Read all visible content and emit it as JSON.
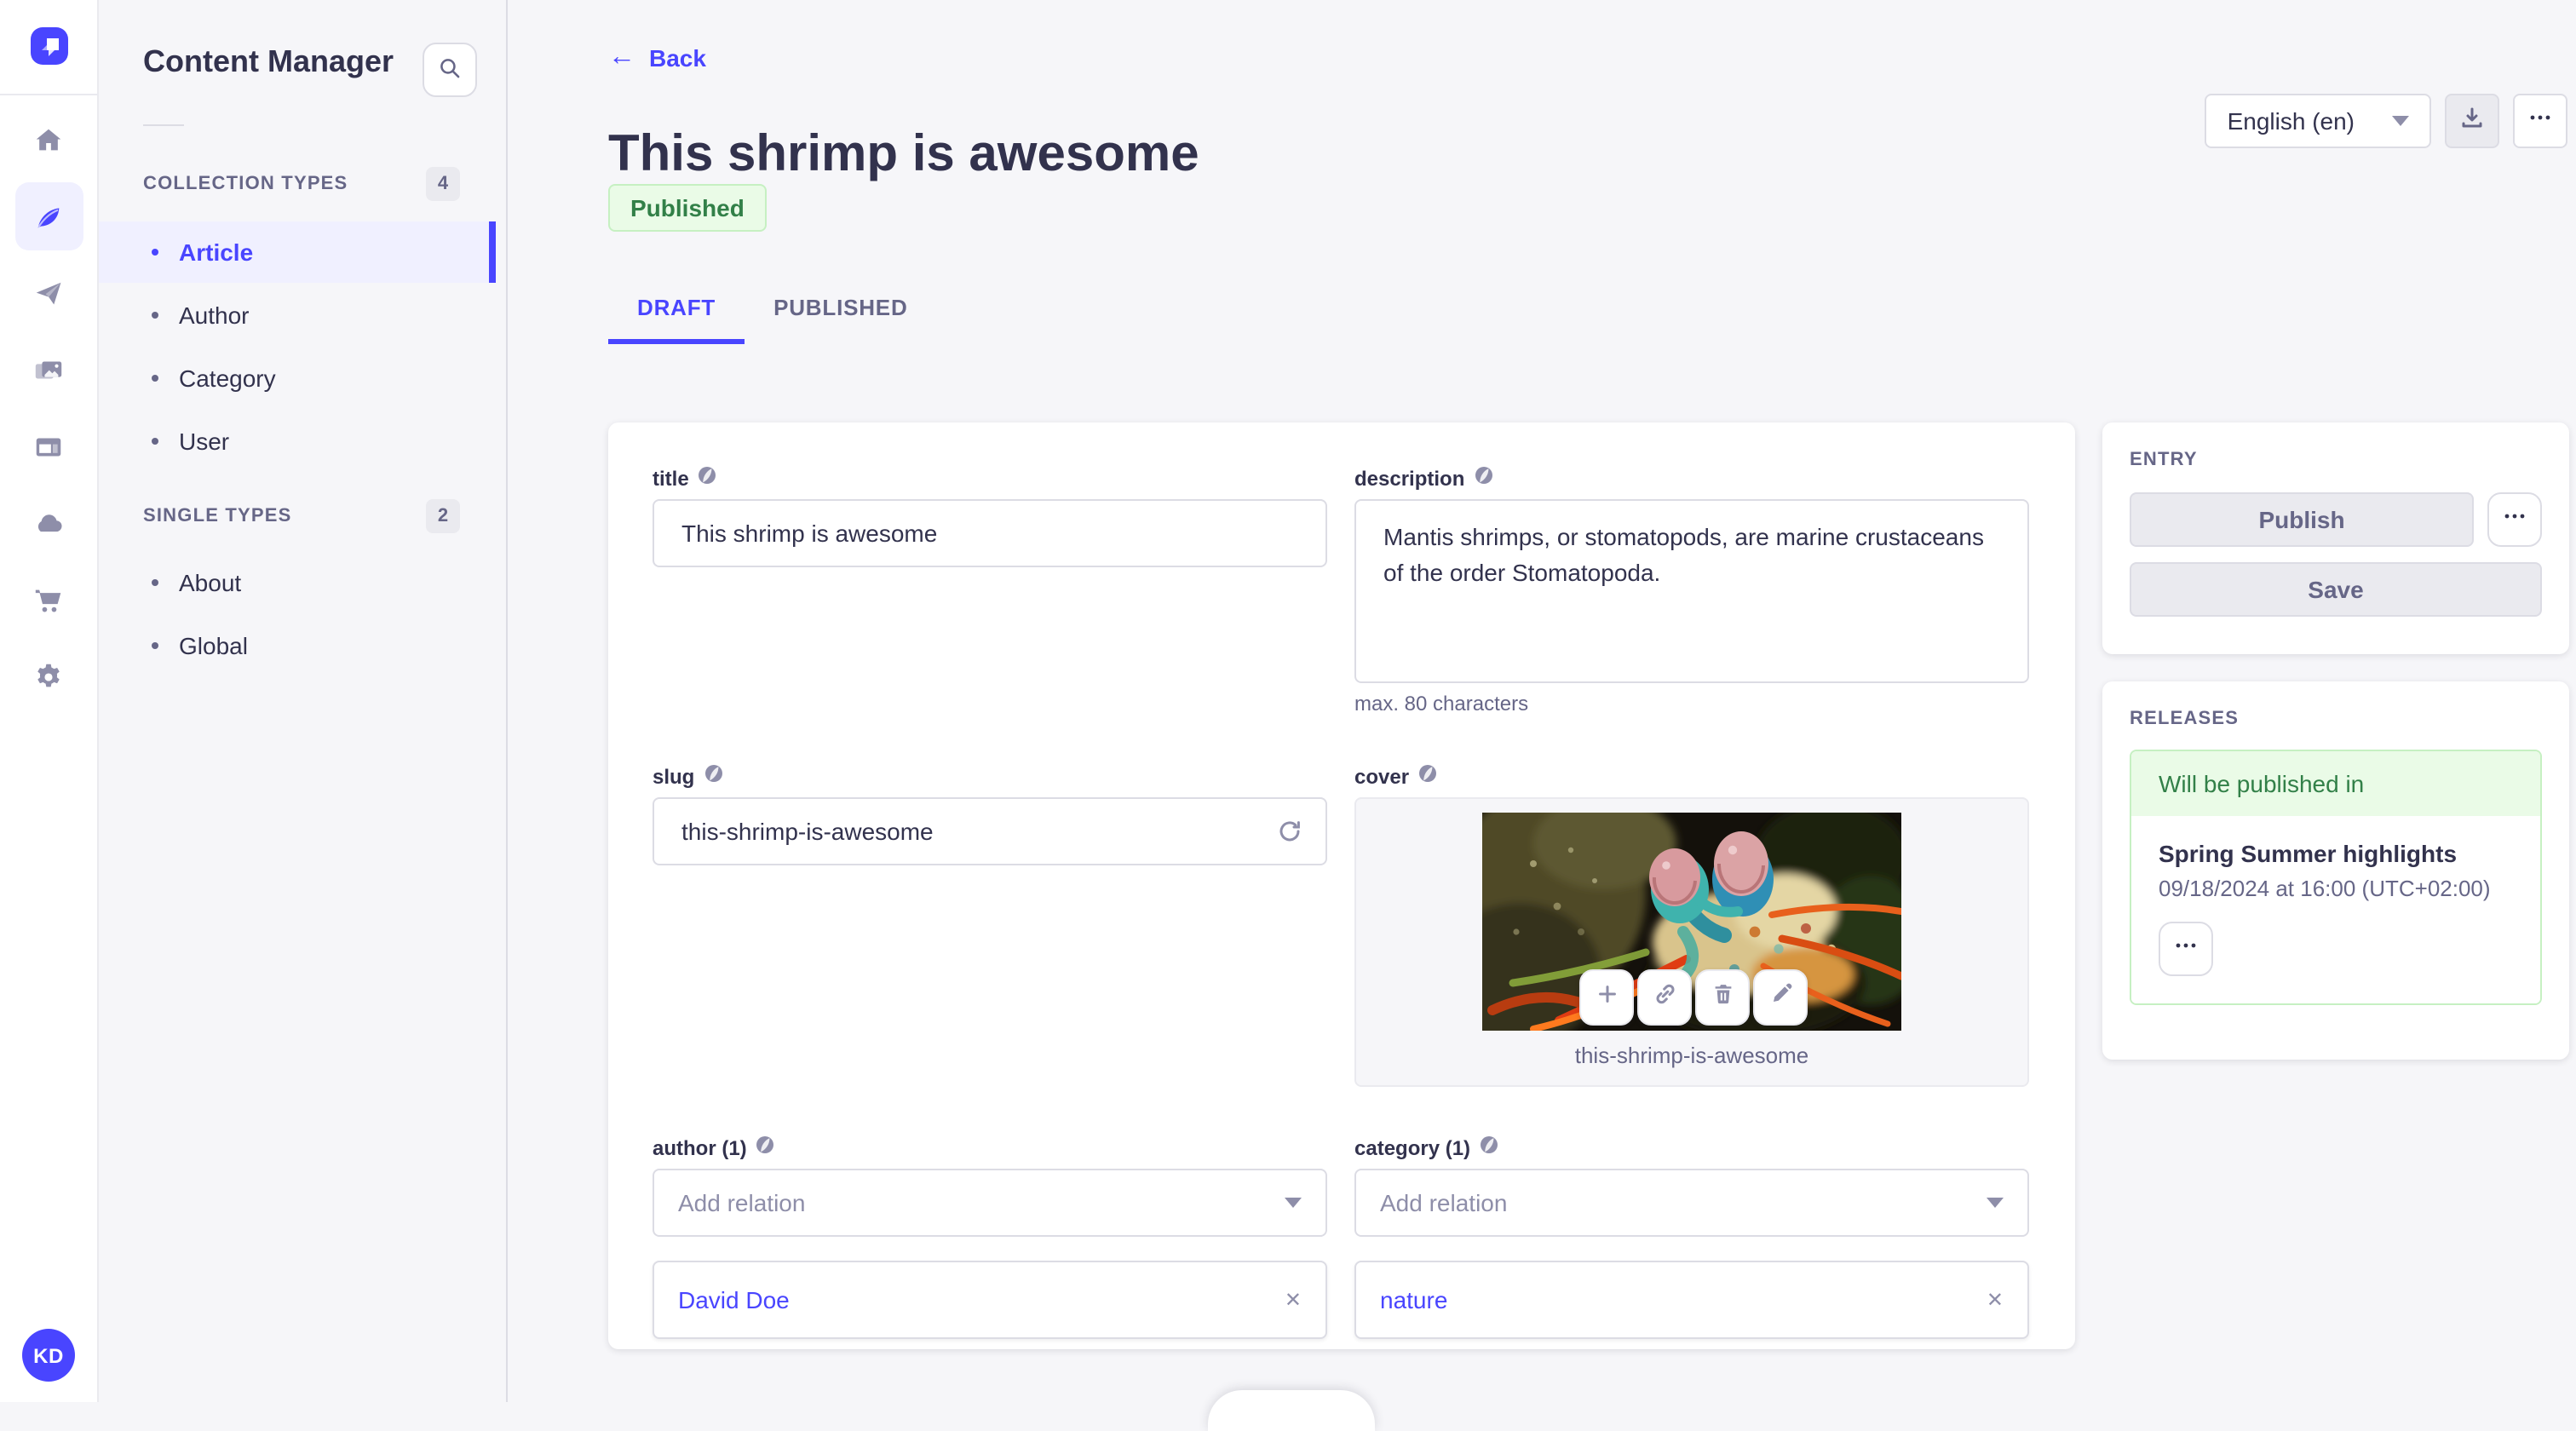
{
  "colors": {
    "accent": "#4945ff",
    "success_text": "#328048",
    "success_bg": "#eafbe7",
    "success_border": "#c6f0c2",
    "text_dark": "#32324d",
    "text_muted": "#666687"
  },
  "rail": {
    "avatar_initials": "KD"
  },
  "subnav": {
    "title": "Content Manager",
    "sections": [
      {
        "label": "COLLECTION TYPES",
        "count": "4",
        "items": [
          {
            "label": "Article"
          },
          {
            "label": "Author"
          },
          {
            "label": "Category"
          },
          {
            "label": "User"
          }
        ]
      },
      {
        "label": "SINGLE TYPES",
        "count": "2",
        "items": [
          {
            "label": "About"
          },
          {
            "label": "Global"
          }
        ]
      }
    ]
  },
  "header": {
    "back": "Back",
    "title": "This shrimp is awesome",
    "status": "Published",
    "locale": "English (en)"
  },
  "tabs": {
    "draft": "DRAFT",
    "published": "PUBLISHED"
  },
  "form": {
    "title": {
      "label": "title",
      "value": "This shrimp is awesome"
    },
    "description": {
      "label": "description",
      "value": "Mantis shrimps, or stomatopods, are marine crustaceans of the order Stomatopoda.",
      "hint": "max. 80 characters"
    },
    "slug": {
      "label": "slug",
      "value": "this-shrimp-is-awesome"
    },
    "cover": {
      "label": "cover",
      "caption": "this-shrimp-is-awesome"
    },
    "author": {
      "label": "author (1)",
      "placeholder": "Add relation",
      "relation": "David Doe"
    },
    "category": {
      "label": "category (1)",
      "placeholder": "Add relation",
      "relation": "nature"
    }
  },
  "entry": {
    "heading": "ENTRY",
    "publish": "Publish",
    "save": "Save"
  },
  "releases": {
    "heading": "RELEASES",
    "status": "Will be published in",
    "title": "Spring Summer highlights",
    "date": "09/18/2024 at 16:00 (UTC+02:00)"
  }
}
